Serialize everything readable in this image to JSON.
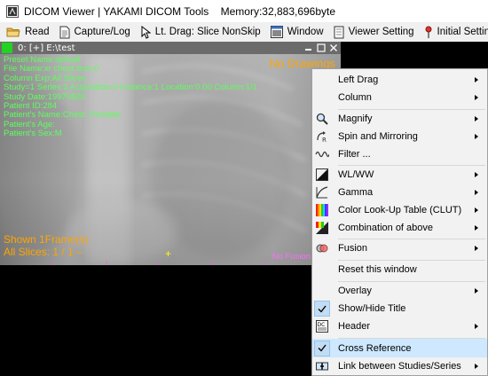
{
  "window": {
    "title": "DICOM Viewer | YAKAMI DICOM Tools",
    "memory": "Memory:32,883,696byte"
  },
  "toolbar": {
    "items": [
      {
        "label": "Read",
        "icon": "folder-icon"
      },
      {
        "label": "Capture/Log",
        "icon": "document-icon"
      },
      {
        "label": "Lt. Drag: Slice NonSkip",
        "icon": "cursor-icon"
      },
      {
        "label": "Window",
        "icon": "window-icon"
      },
      {
        "label": "Viewer Setting",
        "icon": "settings-page-icon"
      },
      {
        "label": "Initial Setting",
        "icon": "pin-icon"
      }
    ]
  },
  "viewer": {
    "window_label": "0: [+] E:\\test",
    "overlay_lines": [
      "Preset Name:default",
      "File Name:xr chest.dcm.0",
      "Column Exp:All Slices",
      "Study=1 Series:1 Acquisition:0 Instance:1 Location:0.00 Column:1/1",
      "Study Date:19970829",
      "Patient ID:284",
      "Patient's Name:Chest, Portable",
      "Patient's Age:",
      "Patient's Sex:M"
    ],
    "no_drawings": "No Drawings",
    "shown_frames": "Shown 1Frame(s)",
    "all_slices": "All Slices: 1 / 1 –",
    "fusion_label": "No Fusion Origin",
    "plus": "+"
  },
  "context_menu": {
    "items": [
      {
        "label": "Left Drag",
        "submenu": true,
        "icon": ""
      },
      {
        "label": "Column",
        "submenu": true,
        "icon": ""
      },
      {
        "label": "Magnify",
        "submenu": true,
        "icon": "magnify-icon"
      },
      {
        "label": "Spin and Mirroring",
        "submenu": true,
        "icon": "spin-icon"
      },
      {
        "label": "Filter ...",
        "submenu": false,
        "icon": "filter-wave-icon"
      },
      {
        "label": "WL/WW",
        "submenu": true,
        "icon": "wlww-icon"
      },
      {
        "label": "Gamma",
        "submenu": true,
        "icon": "gamma-curve-icon"
      },
      {
        "label": "Color Look-Up Table (CLUT)",
        "submenu": true,
        "icon": "clut-icon"
      },
      {
        "label": "Combination of above",
        "submenu": true,
        "icon": "combination-icon"
      },
      {
        "label": "Fusion",
        "submenu": true,
        "icon": "fusion-icon"
      },
      {
        "label": "Reset this window",
        "submenu": false,
        "icon": ""
      },
      {
        "label": "Overlay",
        "submenu": true,
        "icon": ""
      },
      {
        "label": "Show/Hide Title",
        "submenu": false,
        "icon": "",
        "checked": true
      },
      {
        "label": "Header",
        "submenu": true,
        "icon": "header-icon"
      },
      {
        "label": "Cross Reference",
        "submenu": false,
        "icon": "",
        "checked": true,
        "highlighted": true
      },
      {
        "label": "Link between Studies/Series",
        "submenu": true,
        "icon": "link-icon"
      }
    ]
  },
  "colors": {
    "overlay_text": "#5cff5c",
    "no_drawings": "#ffa500",
    "fusion_label": "#ff6bff",
    "menu_highlight": "#cde8ff",
    "active_indicator": "#22d322"
  }
}
